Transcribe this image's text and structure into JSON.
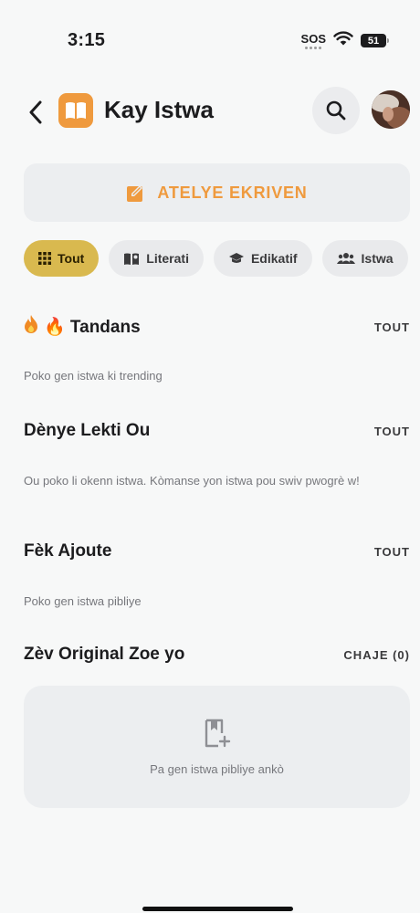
{
  "status_bar": {
    "time": "3:15",
    "sos": "SOS",
    "battery": "51"
  },
  "header": {
    "title": "Kay Istwa",
    "back_icon": "chevron-left-icon",
    "logo_icon": "open-book-icon",
    "search_icon": "search-icon"
  },
  "workshop": {
    "label": "ATELYE EKRIVEN",
    "icon": "edit-square-icon",
    "accent": "#ef9a3e"
  },
  "chips": [
    {
      "label": "Tout",
      "icon": "grid-icon",
      "active": true
    },
    {
      "label": "Literati",
      "icon": "book-reader-icon",
      "active": false
    },
    {
      "label": "Edikatif",
      "icon": "graduation-cap-icon",
      "active": false
    },
    {
      "label": "Istwa",
      "icon": "group-icon",
      "active": false
    }
  ],
  "chip_active_color": "#d9b94f",
  "sections": {
    "trending": {
      "title": "🔥 Tandans",
      "link": "TOUT",
      "empty": "Poko gen istwa ki trending"
    },
    "recent": {
      "title": "Dènye Lekti Ou",
      "link": "TOUT",
      "empty": "Ou poko li okenn istwa. Kòmanse yon istwa pou swiv pwogrè w!"
    },
    "new": {
      "title": "Fèk Ajoute",
      "link": "TOUT",
      "empty": "Poko gen istwa pibliye"
    },
    "originals": {
      "title": "Zèv Original Zoe yo",
      "link": "CHAJE (0)",
      "empty": "Pa gen istwa pibliye ankò"
    }
  }
}
